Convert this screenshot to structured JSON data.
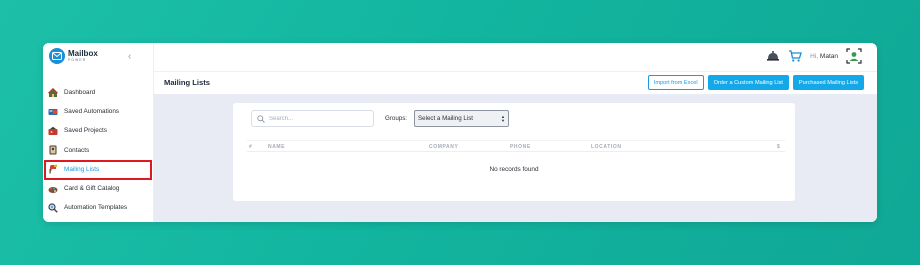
{
  "brand": {
    "title": "Mailbox",
    "subtitle": "POWER"
  },
  "sidebar": {
    "items": [
      {
        "label": "Dashboard",
        "icon": "house-icon"
      },
      {
        "label": "Saved Automations",
        "icon": "saved-automations-icon"
      },
      {
        "label": "Saved Projects",
        "icon": "saved-projects-icon"
      },
      {
        "label": "Contacts",
        "icon": "contacts-book-icon"
      },
      {
        "label": "Mailing Lists",
        "icon": "mailing-lists-icon",
        "active": true
      },
      {
        "label": "Card & Gift Catalog",
        "icon": "gift-catalog-icon"
      },
      {
        "label": "Automation Templates",
        "icon": "templates-icon"
      }
    ]
  },
  "header": {
    "greeting": "Hi,",
    "user": "Matan"
  },
  "page": {
    "title": "Mailing Lists",
    "buttons": {
      "import": "Import from Excel",
      "order": "Order a Custom Mailing List",
      "purchased": "Purchased Mailing Lists"
    }
  },
  "filters": {
    "search_placeholder": "Search...",
    "groups_label": "Groups:",
    "groups_selected": "Select a Mailing List"
  },
  "table": {
    "columns": [
      "#",
      "NAME",
      "COMPANY",
      "PHONE",
      "LOCATION",
      "$"
    ],
    "empty_message": "No records found"
  },
  "colors": {
    "accent": "#15a8e8",
    "highlight": "#e01920",
    "background": "#12b59f"
  }
}
